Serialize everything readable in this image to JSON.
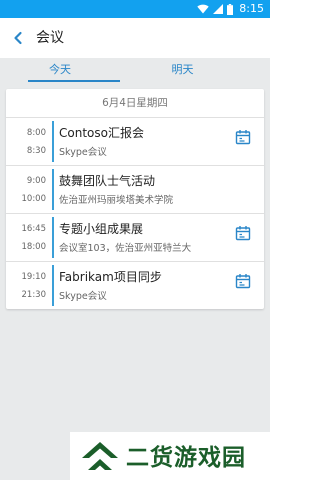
{
  "status_bar": {
    "time": "8:15",
    "color": "#12a1ef",
    "icons": [
      "wifi-icon",
      "signal-icon",
      "battery-icon"
    ]
  },
  "app_bar": {
    "title": "会议",
    "back_icon": "chevron-left-icon"
  },
  "tabs": [
    {
      "label": "今天",
      "selected": true
    },
    {
      "label": "明天",
      "selected": false
    }
  ],
  "accent_color": "#2a86c8",
  "day": {
    "header": "6月4日星期四",
    "events": [
      {
        "start": "8:00",
        "end": "8:30",
        "title": "Contoso汇报会",
        "location": "Skype会议",
        "join_icon": true
      },
      {
        "start": "9:00",
        "end": "10:00",
        "title": "鼓舞团队士气活动",
        "location": "佐治亚州玛丽埃塔美术学院",
        "join_icon": false
      },
      {
        "start": "16:45",
        "end": "18:00",
        "title": "专题小组成果展",
        "location": "会议室103，佐治亚州亚特兰大",
        "join_icon": true
      },
      {
        "start": "19:10",
        "end": "21:30",
        "title": "Fabrikam项目同步",
        "location": "Skype会议",
        "join_icon": true
      }
    ]
  },
  "watermark": {
    "text": "二货游戏园"
  }
}
